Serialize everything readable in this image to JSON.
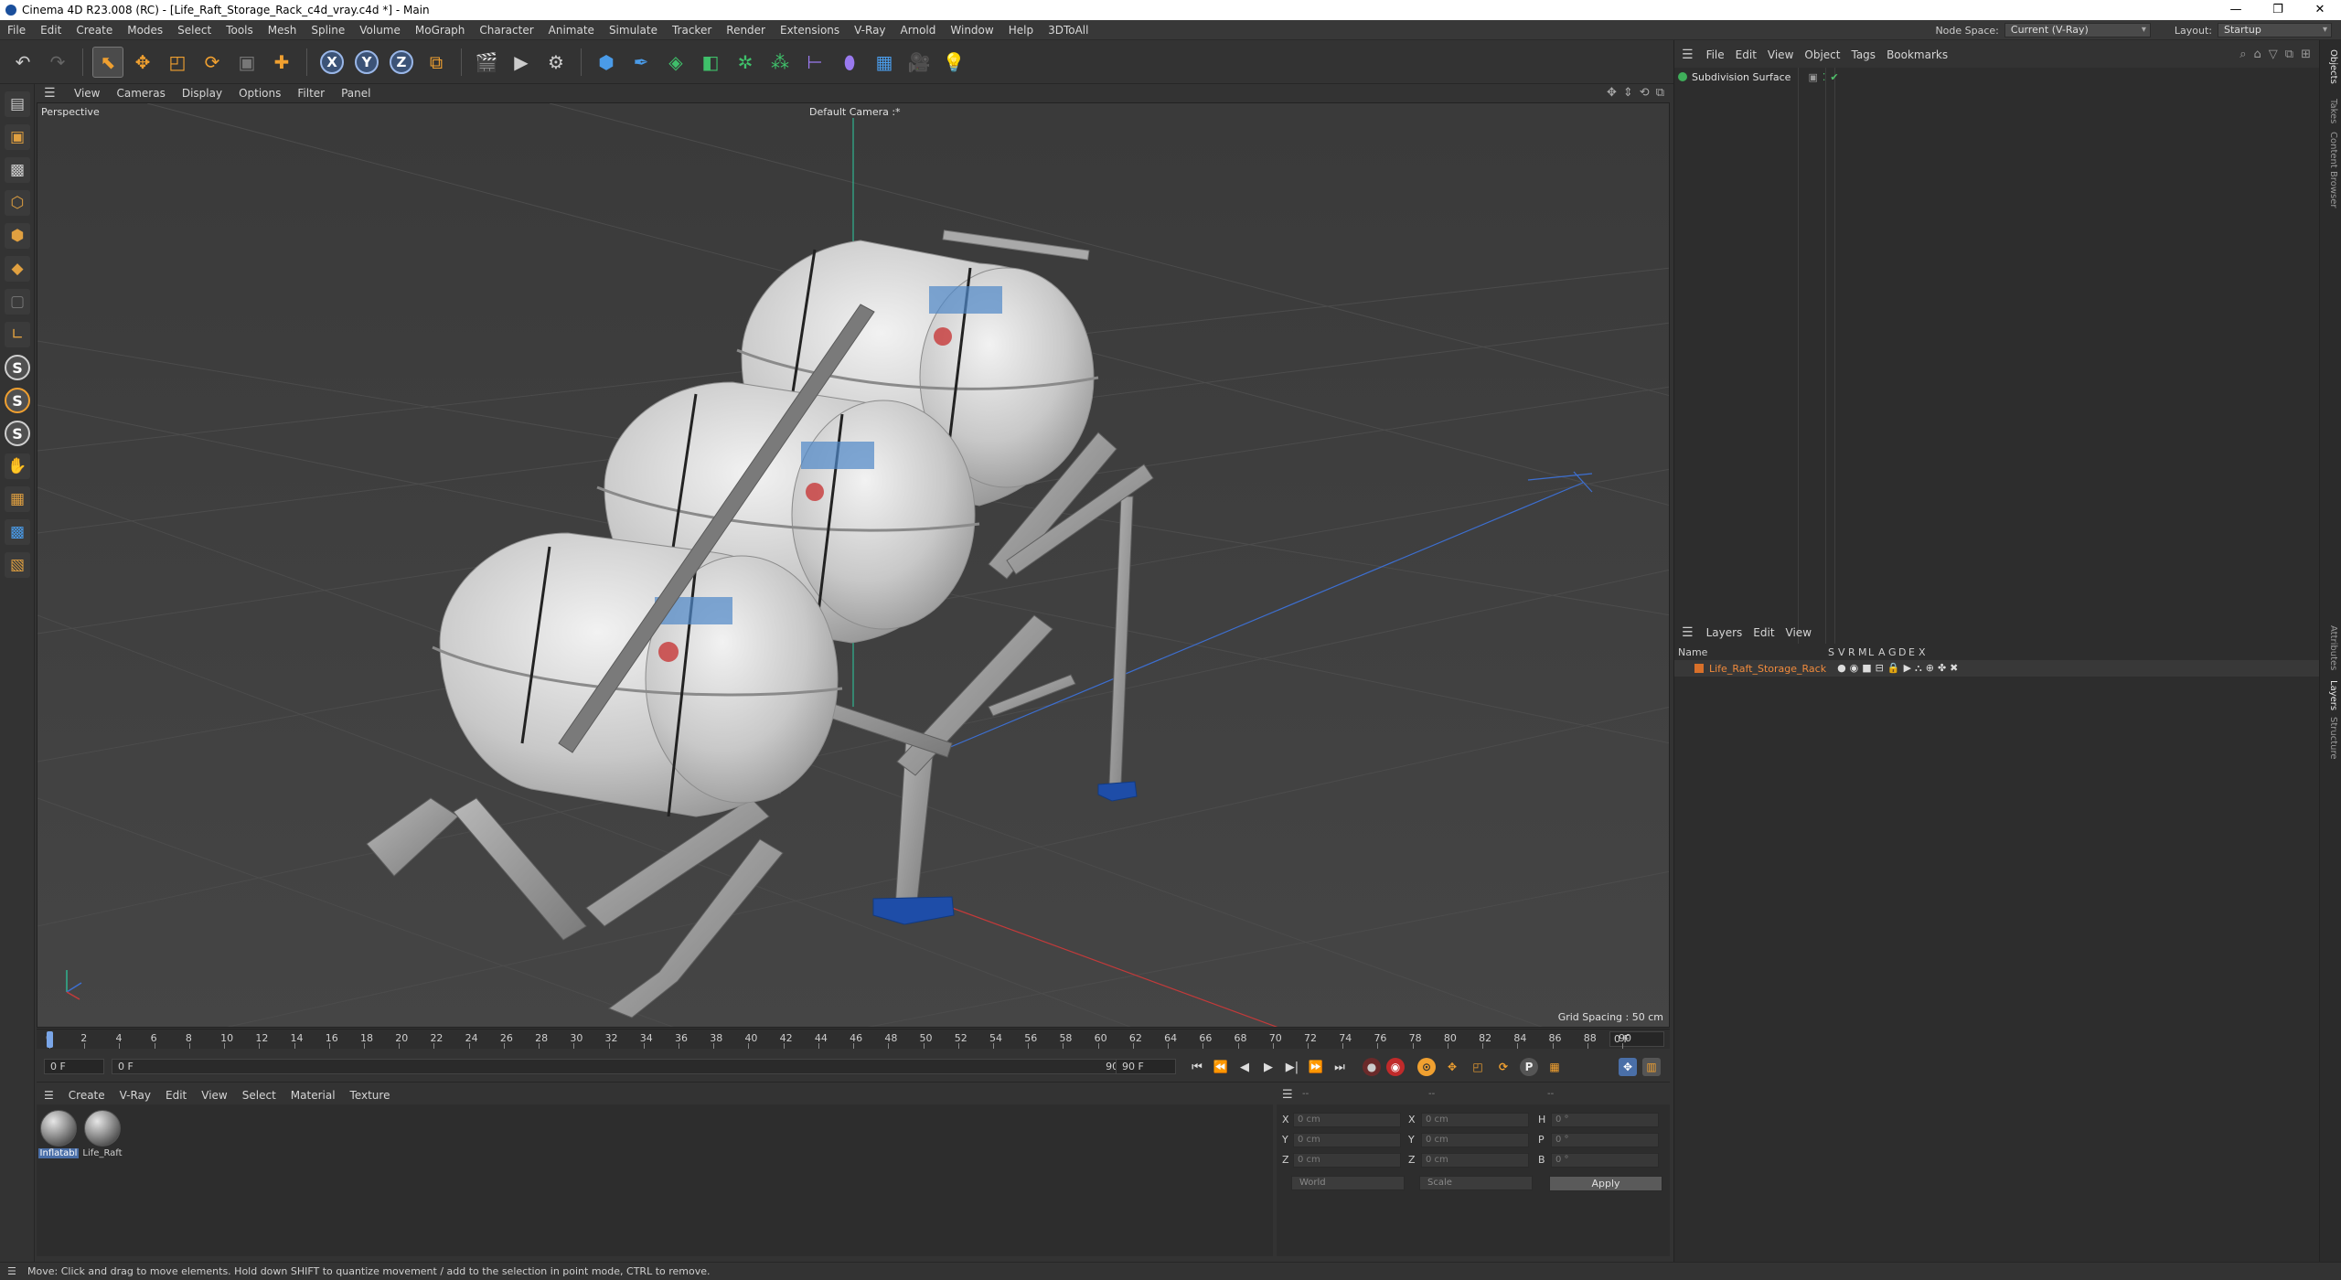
{
  "window": {
    "title": "Cinema 4D R23.008 (RC) - [Life_Raft_Storage_Rack_c4d_vray.c4d *] - Main",
    "controls": [
      "—",
      "❐",
      "✕"
    ]
  },
  "menubar": {
    "items": [
      "File",
      "Edit",
      "Create",
      "Modes",
      "Select",
      "Tools",
      "Mesh",
      "Spline",
      "Volume",
      "MoGraph",
      "Character",
      "Animate",
      "Simulate",
      "Tracker",
      "Render",
      "Extensions",
      "V-Ray",
      "Arnold",
      "Window",
      "Help",
      "3DToAll"
    ],
    "node_space_label": "Node Space:",
    "node_space_value": "Current (V-Ray)",
    "layout_label": "Layout:",
    "layout_value": "Startup"
  },
  "viewport": {
    "menu": [
      "View",
      "Cameras",
      "Display",
      "Options",
      "Filter",
      "Panel"
    ],
    "view_name": "Perspective",
    "camera_name": "Default Camera :*",
    "grid_spacing": "Grid Spacing : 50 cm"
  },
  "timeline": {
    "ticks": [
      "0",
      "2",
      "4",
      "6",
      "8",
      "10",
      "12",
      "14",
      "16",
      "18",
      "20",
      "22",
      "24",
      "26",
      "28",
      "30",
      "32",
      "34",
      "36",
      "38",
      "40",
      "42",
      "44",
      "46",
      "48",
      "50",
      "52",
      "54",
      "56",
      "58",
      "60",
      "62",
      "64",
      "66",
      "68",
      "70",
      "72",
      "74",
      "76",
      "78",
      "80",
      "82",
      "84",
      "86",
      "88",
      "90"
    ],
    "current_frame": "0 F",
    "start_field": "0 F",
    "range_start": "0 F",
    "range_end": "90 F",
    "end_field": "90 F"
  },
  "material_manager": {
    "menu": [
      "Create",
      "V-Ray",
      "Edit",
      "View",
      "Select",
      "Material",
      "Texture"
    ],
    "materials": [
      {
        "name": "Inflatabl",
        "selected": true
      },
      {
        "name": "Life_Raft",
        "selected": false
      }
    ]
  },
  "coordinates": {
    "header": [
      "--",
      "--",
      "--"
    ],
    "rows": [
      {
        "a": "X",
        "av": "0 cm",
        "b": "X",
        "bv": "0 cm",
        "c": "H",
        "cv": "0 °"
      },
      {
        "a": "Y",
        "av": "0 cm",
        "b": "Y",
        "bv": "0 cm",
        "c": "P",
        "cv": "0 °"
      },
      {
        "a": "Z",
        "av": "0 cm",
        "b": "Z",
        "bv": "0 cm",
        "c": "B",
        "cv": "0 °"
      }
    ],
    "mode_dropdown": "World",
    "scale_dropdown": "Scale",
    "apply_label": "Apply"
  },
  "object_manager": {
    "menu": [
      "File",
      "Edit",
      "View",
      "Object",
      "Tags",
      "Bookmarks"
    ],
    "objects": [
      {
        "name": "Subdivision Surface"
      }
    ]
  },
  "layer_manager": {
    "menu": [
      "Layers",
      "Edit",
      "View"
    ],
    "columns": [
      "Name",
      "S",
      "V",
      "R",
      "M",
      "L",
      "A",
      "G",
      "D",
      "E",
      "X"
    ],
    "layers": [
      {
        "name": "Life_Raft_Storage_Rack",
        "color": "#d8702a"
      }
    ]
  },
  "side_tabs": [
    "Objects",
    "Takes",
    "Content Browser",
    "Attributes",
    "Layers",
    "Structure"
  ],
  "status": {
    "text": "Move: Click and drag to move elements. Hold down SHIFT to quantize movement / add to the selection in point mode, CTRL to remove."
  }
}
